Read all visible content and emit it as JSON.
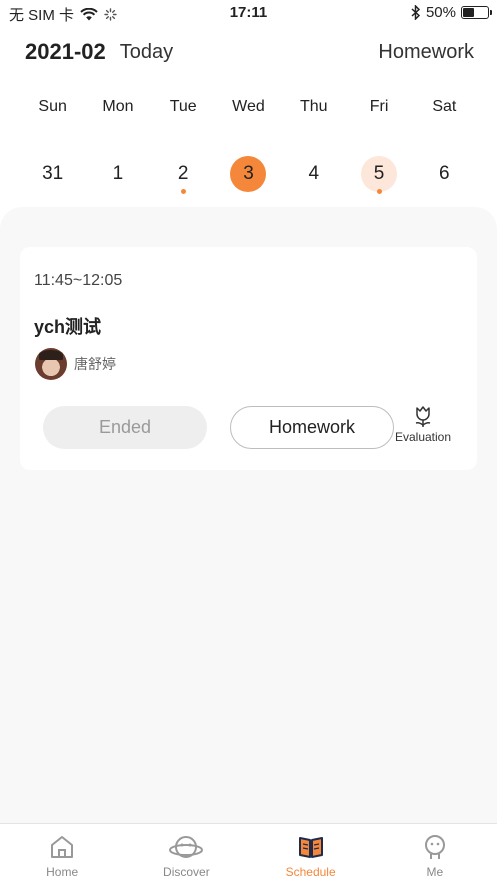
{
  "status_bar": {
    "carrier": "无 SIM 卡",
    "time": "17:11",
    "battery_text": "50%",
    "battery_level": 0.5
  },
  "header": {
    "month": "2021-02",
    "today_label": "Today",
    "homework_label": "Homework"
  },
  "week": {
    "days": [
      "Sun",
      "Mon",
      "Tue",
      "Wed",
      "Thu",
      "Fri",
      "Sat"
    ],
    "dates": [
      {
        "num": "31",
        "state": "normal",
        "dot": false
      },
      {
        "num": "1",
        "state": "normal",
        "dot": false
      },
      {
        "num": "2",
        "state": "normal",
        "dot": true
      },
      {
        "num": "3",
        "state": "selected",
        "dot": false
      },
      {
        "num": "4",
        "state": "normal",
        "dot": false
      },
      {
        "num": "5",
        "state": "today",
        "dot": true
      },
      {
        "num": "6",
        "state": "normal",
        "dot": false
      }
    ]
  },
  "lesson": {
    "time_range": "11:45~12:05",
    "title": "ych测试",
    "teacher": "唐舒婷",
    "ended_label": "Ended",
    "homework_label": "Homework",
    "evaluation_label": "Evaluation"
  },
  "tabbar": {
    "items": [
      {
        "label": "Home",
        "icon": "home-icon",
        "active": false
      },
      {
        "label": "Discover",
        "icon": "planet-icon",
        "active": false
      },
      {
        "label": "Schedule",
        "icon": "book-icon",
        "active": true
      },
      {
        "label": "Me",
        "icon": "face-icon",
        "active": false
      }
    ]
  },
  "colors": {
    "accent": "#f5873a",
    "accent_light": "#fde6da",
    "panel_bg": "#f8f8f8"
  }
}
